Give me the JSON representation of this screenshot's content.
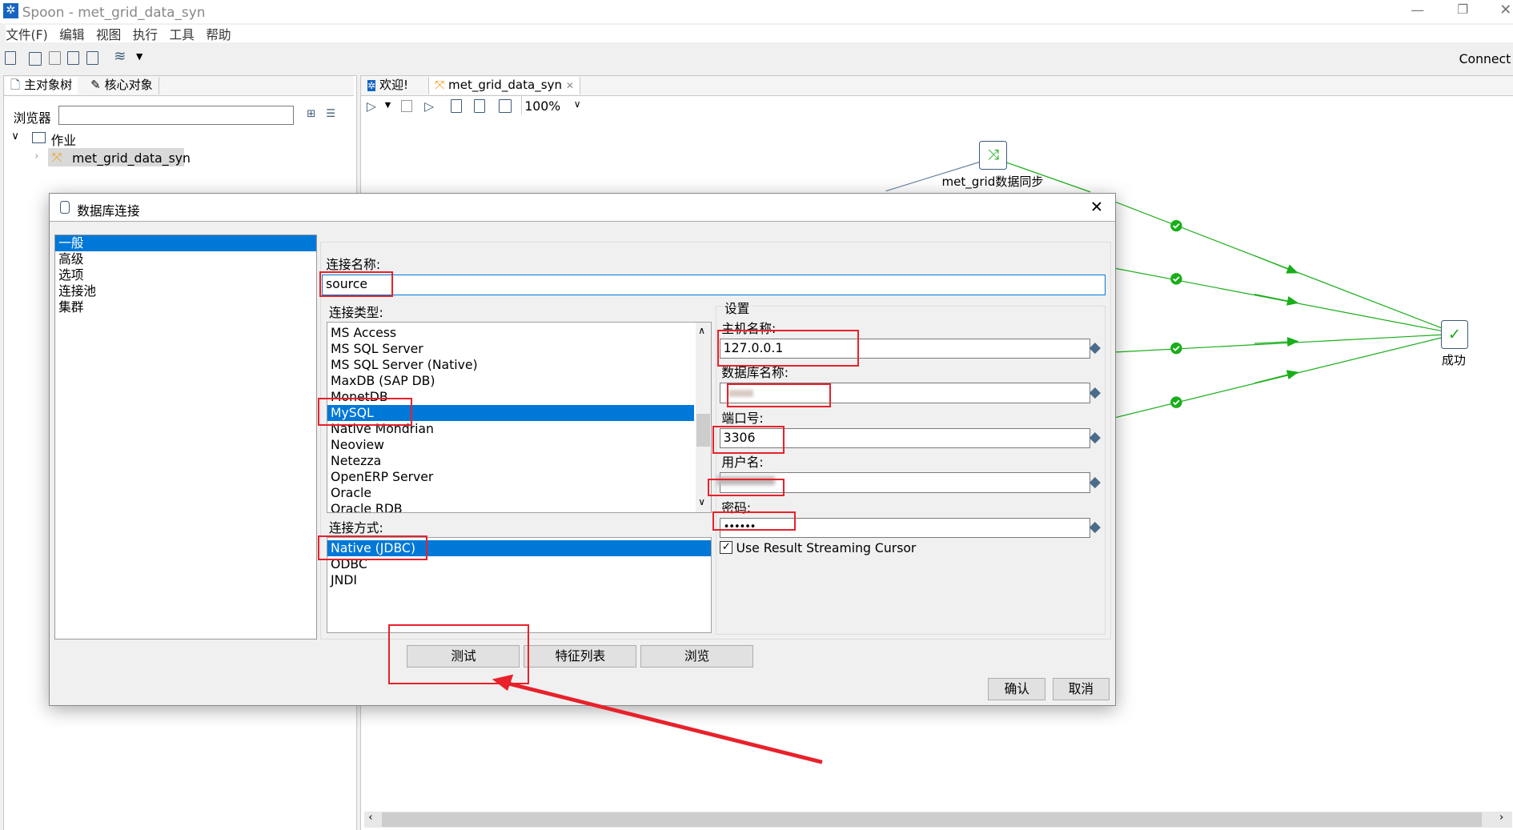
{
  "window": {
    "title": "Spoon - met_grid_data_syn",
    "connect_label": "Connect"
  },
  "menu": [
    "文件(F)",
    "编辑",
    "视图",
    "执行",
    "工具",
    "帮助"
  ],
  "left_panel": {
    "tabs": [
      {
        "label": "主对象树"
      },
      {
        "label": "核心对象"
      }
    ],
    "search_label": "浏览器",
    "search_value": "",
    "tree": {
      "folder": "作业",
      "item": "met_grid_data_syn"
    }
  },
  "editor": {
    "tabs": [
      {
        "label": "欢迎!"
      },
      {
        "label": "met_grid_data_syn"
      }
    ],
    "zoom": "100%",
    "nodes": {
      "sync": "met_grid数据同步",
      "success": "成功"
    }
  },
  "dialog": {
    "title": "数据库连接",
    "nav": [
      "一般",
      "高级",
      "选项",
      "连接池",
      "集群"
    ],
    "nav_selected": "一般",
    "connection_name_label": "连接名称:",
    "connection_name": "source",
    "connection_type_label": "连接类型:",
    "connection_types": [
      "MS Access",
      "MS SQL Server",
      "MS SQL Server (Native)",
      "MaxDB (SAP DB)",
      "MonetDB",
      "MySQL",
      "Native Mondrian",
      "Neoview",
      "Netezza",
      "OpenERP Server",
      "Oracle",
      "Oracle RDB"
    ],
    "connection_type_selected": "MySQL",
    "access_label": "连接方式:",
    "access_types": [
      "Native (JDBC)",
      "ODBC",
      "JNDI"
    ],
    "access_selected": "Native (JDBC)",
    "settings": {
      "title": "设置",
      "host_label": "主机名称:",
      "host": "127.0.0.1",
      "db_label": "数据库名称:",
      "port_label": "端口号:",
      "port": "3306",
      "user_label": "用户名:",
      "password_label": "密码:",
      "password": "••••••",
      "streaming_label": "Use Result Streaming Cursor",
      "streaming_checked": true
    },
    "buttons": {
      "test": "测试",
      "features": "特征列表",
      "explore": "浏览",
      "ok": "确认",
      "cancel": "取消"
    }
  },
  "colors": {
    "selection": "#0078d7",
    "annotation": "#e8212a",
    "hop": "#1aae1a"
  }
}
